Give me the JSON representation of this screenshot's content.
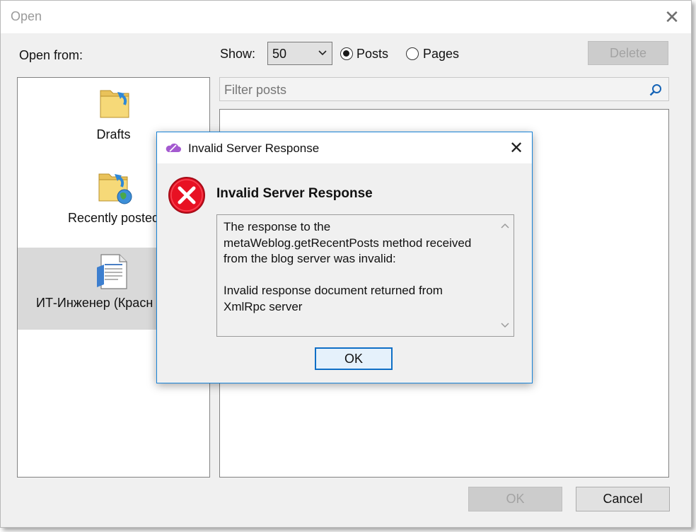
{
  "window": {
    "title": "Open"
  },
  "open_from": {
    "label": "Open from:"
  },
  "toolbar": {
    "show_label": "Show:",
    "show_value": "50",
    "radio_posts": {
      "label": "Posts",
      "checked": true
    },
    "radio_pages": {
      "label": "Pages",
      "checked": false
    },
    "delete_label": "Delete"
  },
  "sources": [
    {
      "label": "Drafts",
      "icon": "drafts-folder-icon"
    },
    {
      "label": "Recently posted",
      "icon": "recently-posted-folder-icon"
    },
    {
      "label": "ИТ-Инженер (Красн",
      "icon": "blog-document-icon",
      "selected": true
    }
  ],
  "filter": {
    "placeholder": "Filter posts"
  },
  "footer": {
    "ok_label": "OK",
    "cancel_label": "Cancel"
  },
  "dialog": {
    "title": "Invalid Server Response",
    "heading": "Invalid Server Response",
    "message": "The response to the\nmetaWeblog.getRecentPosts method received\nfrom the blog server was invalid:\n\nInvalid response document returned from\nXmlRpc server",
    "ok_label": "OK"
  },
  "colors": {
    "accent": "#1883d7",
    "error_red": "#e81123",
    "app_purple": "#a45ad0"
  }
}
